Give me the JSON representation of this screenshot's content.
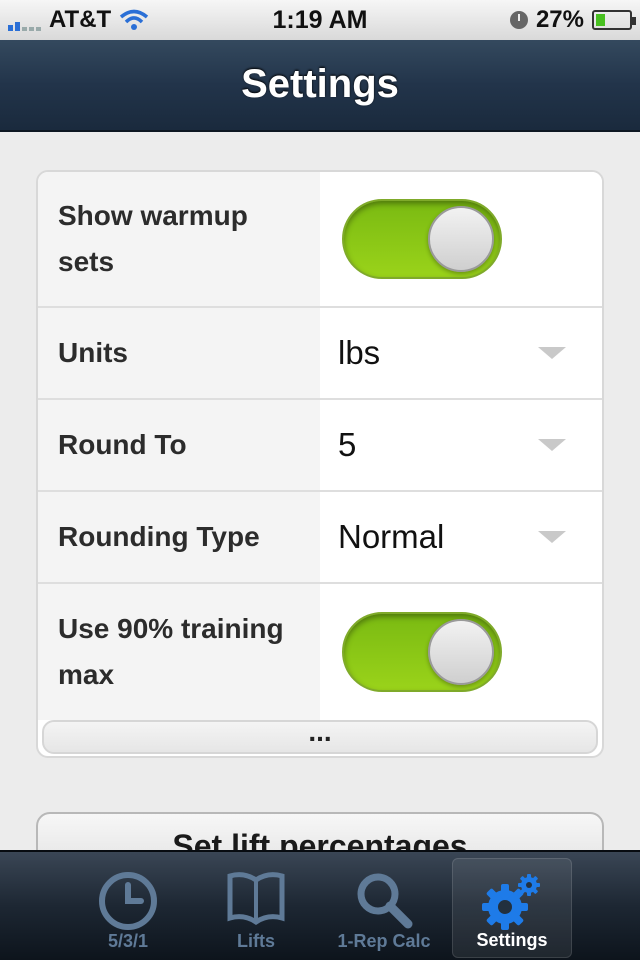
{
  "status_bar": {
    "carrier": "AT&T",
    "time": "1:19 AM",
    "battery": "27%"
  },
  "header": {
    "title": "Settings"
  },
  "settings": {
    "show_warmup": {
      "label": "Show warmup sets",
      "enabled": true
    },
    "units": {
      "label": "Units",
      "value": "lbs"
    },
    "round_to": {
      "label": "Round To",
      "value": "5"
    },
    "rounding_type": {
      "label": "Rounding Type",
      "value": "Normal"
    },
    "training_max": {
      "label": "Use 90% training max",
      "enabled": true
    },
    "more": "..."
  },
  "lift_button": {
    "label": "Set lift percentages"
  },
  "tabs": [
    {
      "label": "5/3/1",
      "icon": "clock-icon"
    },
    {
      "label": "Lifts",
      "icon": "book-icon"
    },
    {
      "label": "1-Rep Calc",
      "icon": "magnifier-icon"
    },
    {
      "label": "Settings",
      "icon": "gear-icon",
      "active": true
    }
  ],
  "colors": {
    "toggle_on": "#8cc814",
    "nav_bg": "#22344a",
    "active_tab_icon": "#1e7be8",
    "inactive_tab": "#5f7a97"
  }
}
